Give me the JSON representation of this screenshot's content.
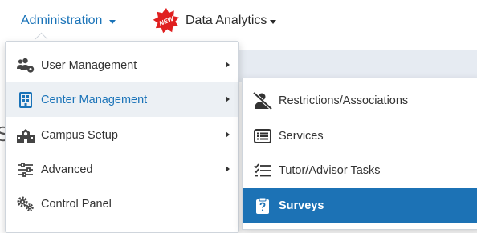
{
  "topnav": {
    "administration_label": "Administration",
    "data_analytics_label": "Data Analytics",
    "new_badge_text": "NEW"
  },
  "background": {
    "partial_letter": "S"
  },
  "admin_menu": {
    "items": [
      {
        "label": "User Management",
        "icon": "users-cog-icon",
        "has_submenu": true
      },
      {
        "label": "Center Management",
        "icon": "building-icon",
        "has_submenu": true,
        "active": true
      },
      {
        "label": "Campus Setup",
        "icon": "school-icon",
        "has_submenu": true
      },
      {
        "label": "Advanced",
        "icon": "sliders-icon",
        "has_submenu": true
      },
      {
        "label": "Control Panel",
        "icon": "cogs-icon",
        "has_submenu": false
      }
    ]
  },
  "center_submenu": {
    "items": [
      {
        "label": "Restrictions/Associations",
        "icon": "user-slash-icon"
      },
      {
        "label": "Services",
        "icon": "list-icon"
      },
      {
        "label": "Tutor/Advisor Tasks",
        "icon": "tasks-icon"
      },
      {
        "label": "Surveys",
        "icon": "clipboard-question-icon",
        "selected": true
      }
    ]
  },
  "colors": {
    "link_blue": "#1a73b8",
    "selected_bg": "#1c72b5",
    "hover_bg": "#ecf0f4",
    "badge_red": "#e02020"
  }
}
